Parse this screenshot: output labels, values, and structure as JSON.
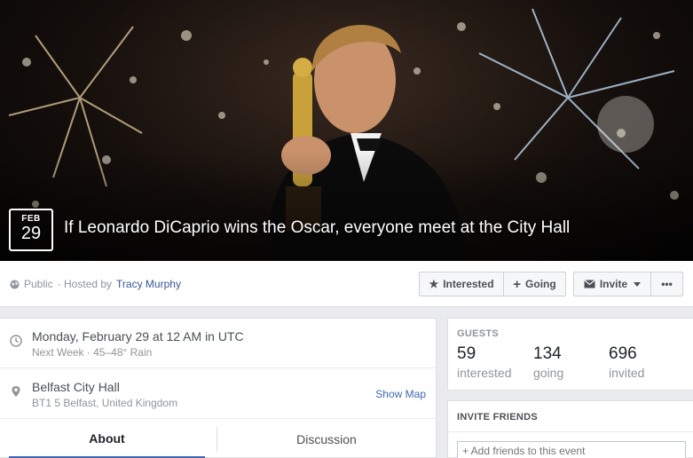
{
  "cover": {
    "date_month": "FEB",
    "date_day": "29",
    "title": "If Leonardo DiCaprio wins the Oscar, everyone meet at the City Hall"
  },
  "action_bar": {
    "privacy": "Public",
    "hosted_by_prefix": "· Hosted by",
    "host": "Tracy Murphy",
    "interested_label": "Interested",
    "going_label": "Going",
    "invite_label": "Invite",
    "more_label": "•••"
  },
  "details": {
    "time_main": "Monday, February 29 at 12 AM in UTC",
    "time_sub": "Next Week · 45–48° Rain",
    "place_main": "Belfast City Hall",
    "place_sub": "BT1 5 Belfast, United Kingdom",
    "show_map": "Show Map",
    "tabs": [
      "About",
      "Discussion"
    ]
  },
  "guests": {
    "heading": "GUESTS",
    "stats": [
      {
        "count": "59",
        "label": "interested"
      },
      {
        "count": "134",
        "label": "going"
      },
      {
        "count": "696",
        "label": "invited"
      }
    ]
  },
  "invite": {
    "heading": "INVITE FRIENDS",
    "placeholder": "+ Add friends to this event"
  },
  "colors": {
    "accent": "#4267b2",
    "link": "#365899",
    "muted": "#90949c",
    "background": "#e9ebee"
  },
  "icons": {
    "privacy": "globe-icon",
    "interested": "star-icon",
    "going": "plus-icon",
    "invite": "envelope-icon",
    "time": "clock-icon",
    "place": "map-pin-icon"
  }
}
